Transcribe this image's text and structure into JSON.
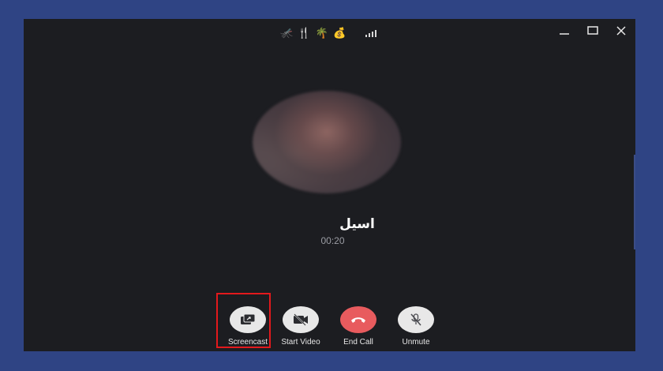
{
  "window": {
    "title_emojis": "🦟 🍴 🌴 💰",
    "controls": {
      "minimize_icon": "minimize-icon",
      "maximize_icon": "maximize-icon",
      "close_icon": "close-icon"
    }
  },
  "call": {
    "caller_name": "اسيل",
    "timer": "00:20"
  },
  "buttons": {
    "screencast": "Screencast",
    "start_video": "Start Video",
    "end_call": "End Call",
    "unmute": "Unmute"
  },
  "colors": {
    "background": "#2f4484",
    "window": "#1c1d21",
    "end_call": "#e85b5e",
    "highlight": "#e3191c"
  }
}
